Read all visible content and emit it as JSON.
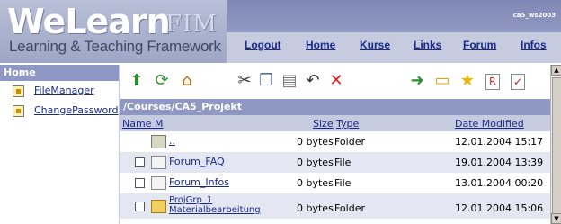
{
  "header": {
    "logo_main": "WeLearn",
    "logo_fim": "FIM",
    "logo_sub": "Learning & Teaching Framework",
    "user": "ca5_ws2003",
    "nav": [
      "Logout",
      "Home",
      "Kurse",
      "Links",
      "Forum",
      "Infos"
    ]
  },
  "sidebar": {
    "title": "Home",
    "items": [
      {
        "label": "FileManager"
      },
      {
        "label": "ChangePassword"
      }
    ]
  },
  "toolbar": {
    "icons": [
      "upload-icon",
      "refresh-icon",
      "home-icon",
      "cut-icon",
      "copy-icon",
      "paste-icon",
      "undo-icon",
      "delete-icon",
      "go-icon",
      "new-folder-icon",
      "favorite-icon",
      "rename-icon",
      "edit-icon"
    ]
  },
  "path": "/Courses/CA5_Projekt",
  "columns": {
    "name": "Name M",
    "size": "Size",
    "type": "Type",
    "date": "Date Modified"
  },
  "rows": [
    {
      "name": "..",
      "size": "0 bytes",
      "type": "Folder",
      "date": "12.01.2004 15:17",
      "checkbox": false,
      "icon": "parent-folder-icon"
    },
    {
      "name": "Forum_FAQ",
      "size": "0 bytes",
      "type": "File",
      "date": "19.01.2004 13:39",
      "checkbox": true,
      "icon": "link-file-icon"
    },
    {
      "name": "Forum_Infos",
      "size": "0 bytes",
      "type": "File",
      "date": "13.01.2004 00:20",
      "checkbox": true,
      "icon": "link-file-icon"
    },
    {
      "name_line1": "ProjGrp_1",
      "name_line2": "Materialbearbeitung",
      "size": "0 bytes",
      "type": "Folder",
      "date": "12.01.2004 15:06",
      "checkbox": true,
      "icon": "folder-icon"
    }
  ],
  "colors": {
    "accent": "#8f98c2",
    "nav_bg": "#c6cbe0",
    "link": "#1a2a8a",
    "row_alt": "#e4e6f1"
  }
}
